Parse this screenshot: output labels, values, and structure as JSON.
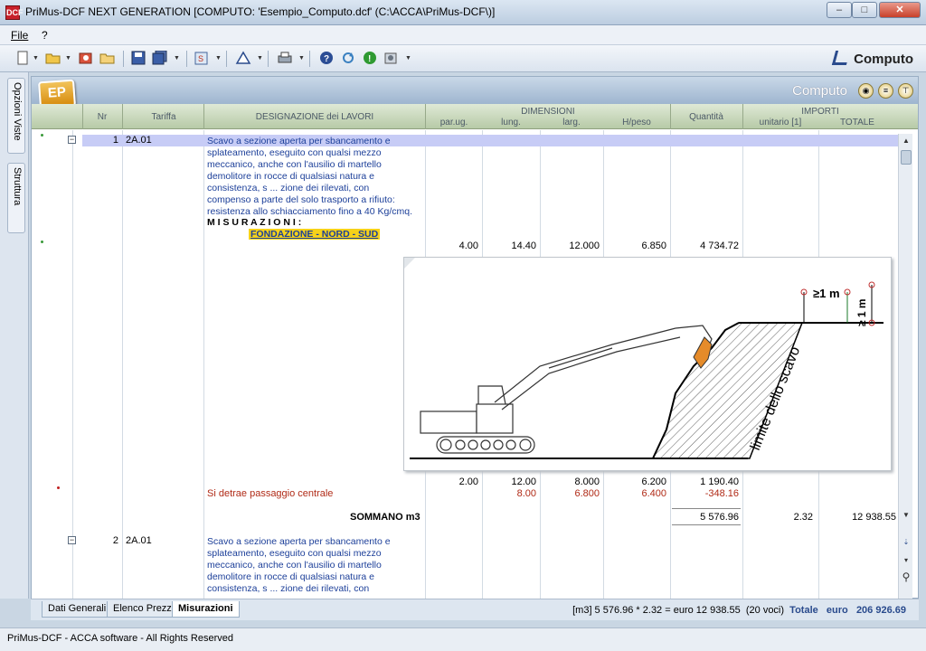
{
  "window": {
    "app_icon": "DCF",
    "title": "PriMus-DCF   NEXT GENERATION   [COMPUTO: 'Esempio_Computo.dcf'    (C:\\ACCA\\PriMus-DCF\\)]",
    "controls": [
      "–",
      "□",
      "✕"
    ]
  },
  "menu": [
    "File",
    "?"
  ],
  "toolbar": {
    "right_label": "Computo",
    "icons": [
      "new-document-icon",
      "open-folder-icon",
      "import-icon",
      "folder-icon",
      "save-icon",
      "save-all-icon",
      "dcf-icon",
      "alert-icon",
      "print-icon",
      "help-icon",
      "refresh-icon",
      "info-icon",
      "settings-icon"
    ]
  },
  "side_tabs": [
    "Opzioni Viste",
    "Struttura"
  ],
  "panel": {
    "logo": "EP",
    "title": "Computo"
  },
  "columns": {
    "nr": "Nr",
    "tariffa": "Tariffa",
    "designazione": "DESIGNAZIONE dei LAVORI",
    "dimensioni": "DIMENSIONI",
    "par_ug": "par.ug.",
    "lung": "lung.",
    "larg": "larg.",
    "hpeso": "H/peso",
    "quantita": "Quantità",
    "importi": "IMPORTI",
    "unitario": "unitario [1]",
    "totale": "TOTALE"
  },
  "rows": {
    "item1": {
      "nr": "1",
      "tariffa": "2A.01",
      "desc_lines": [
        "Scavo a sezione aperta per sbancamento e",
        "splateamento, eseguito con qualsi mezzo",
        "meccanico, anche con l'ausilio di martello",
        "demolitore in rocce di qualsiasi natura e",
        "consistenza, s ... zione dei rilevati, con",
        "compenso a parte del solo trasporto a rifiuto:",
        "resistenza allo schiacciamento fino a 40 Kg/cmq."
      ],
      "misurazioni": "M I S U R A Z I O N I :",
      "group_label": "FONDAZIONE - NORD - SUD",
      "m1": {
        "par": "4.00",
        "lung": "14.40",
        "larg": "12.000",
        "h": "6.850",
        "q": "4 734.72"
      },
      "m2": {
        "par": "2.00",
        "lung": "12.00",
        "larg": "8.000",
        "h": "6.200",
        "q": "1 190.40"
      },
      "m3_label": "Si detrae passaggio centrale",
      "m3": {
        "lung": "8.00",
        "larg": "6.800",
        "h": "6.400",
        "q": "-348.16"
      },
      "sommano": "SOMMANO m3",
      "sum_q": "5 576.96",
      "unit": "2.32",
      "total": "12 938.55"
    },
    "item2": {
      "nr": "2",
      "tariffa": "2A.01",
      "desc_lines": [
        "Scavo a sezione aperta per sbancamento e",
        "splateamento, eseguito con qualsi mezzo",
        "meccanico, anche con l'ausilio di martello",
        "demolitore in rocce di qualsiasi natura e",
        "consistenza, s ... zione dei rilevati, con"
      ]
    }
  },
  "figure": {
    "label_1m_a": "≥1 m",
    "label_1m_b": "≥ 1 m",
    "label_limit": "limite dello scavo"
  },
  "bottom_tabs": [
    "Dati Generali",
    "Elenco Prezz",
    "Misurazioni"
  ],
  "totals": {
    "formula": "[m3] 5 576.96 * 2.32 = euro 12 938.55",
    "count": "(20 voci)",
    "label": "Totale",
    "currency": "euro",
    "value": "206 926.69"
  },
  "status": "PriMus-DCF - ACCA software - All Rights Reserved",
  "colors": {
    "blue_text": "#1c3f99",
    "red_text": "#b02a16",
    "highlight": "#f6d21a",
    "row_band": "#c7ccf6"
  }
}
